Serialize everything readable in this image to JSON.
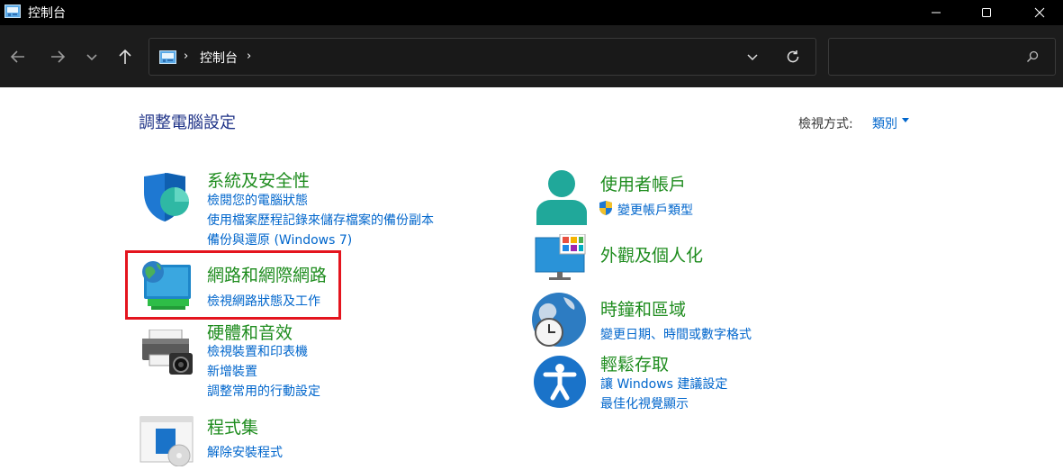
{
  "window": {
    "title": "控制台",
    "controls": {
      "minimize": "minimize-icon",
      "maximize": "maximize-icon",
      "close": "close-icon"
    }
  },
  "toolbar": {
    "buttons": [
      "back-arrow-icon",
      "forward-arrow-icon",
      "chevron-down-icon",
      "up-arrow-icon"
    ],
    "address": {
      "icon": "control-panel-icon",
      "breadcrumb": "控制台",
      "separator": "›"
    },
    "search": {
      "placeholder": "",
      "value": ""
    }
  },
  "header": {
    "title": "調整電腦設定",
    "view_by_label": "檢視方式:",
    "view_by_value": "類別"
  },
  "categories": {
    "system": {
      "title": "系統及安全性",
      "icon": "shield-icon",
      "links": [
        "檢閱您的電腦狀態",
        "使用檔案歷程記錄來儲存檔案的備份副本",
        "備份與還原 (Windows 7)"
      ]
    },
    "network": {
      "title": "網路和網際網路",
      "icon": "network-globe-icon",
      "links": [
        "檢視網路狀態及工作"
      ]
    },
    "hardware": {
      "title": "硬體和音效",
      "icon": "printer-icon",
      "links": [
        "檢視裝置和印表機",
        "新增裝置",
        "調整常用的行動設定"
      ]
    },
    "programs": {
      "title": "程式集",
      "icon": "programs-icon",
      "links": [
        "解除安裝程式"
      ]
    },
    "user": {
      "title": "使用者帳戶",
      "icon": "user-icon",
      "links": [
        "變更帳戶類型"
      ]
    },
    "appearance": {
      "title": "外觀及個人化",
      "icon": "monitor-icon",
      "links": []
    },
    "clock": {
      "title": "時鐘和區域",
      "icon": "clock-globe-icon",
      "links": [
        "變更日期、時間或數字格式"
      ]
    },
    "access": {
      "title": "輕鬆存取",
      "icon": "accessibility-icon",
      "links": [
        "讓 Windows 建議設定",
        "最佳化視覺顯示"
      ]
    }
  },
  "colors": {
    "category_title": "#1e8c1e",
    "link": "#0066cc",
    "page_title": "#1e3287",
    "highlight_box": "#e4141e"
  }
}
